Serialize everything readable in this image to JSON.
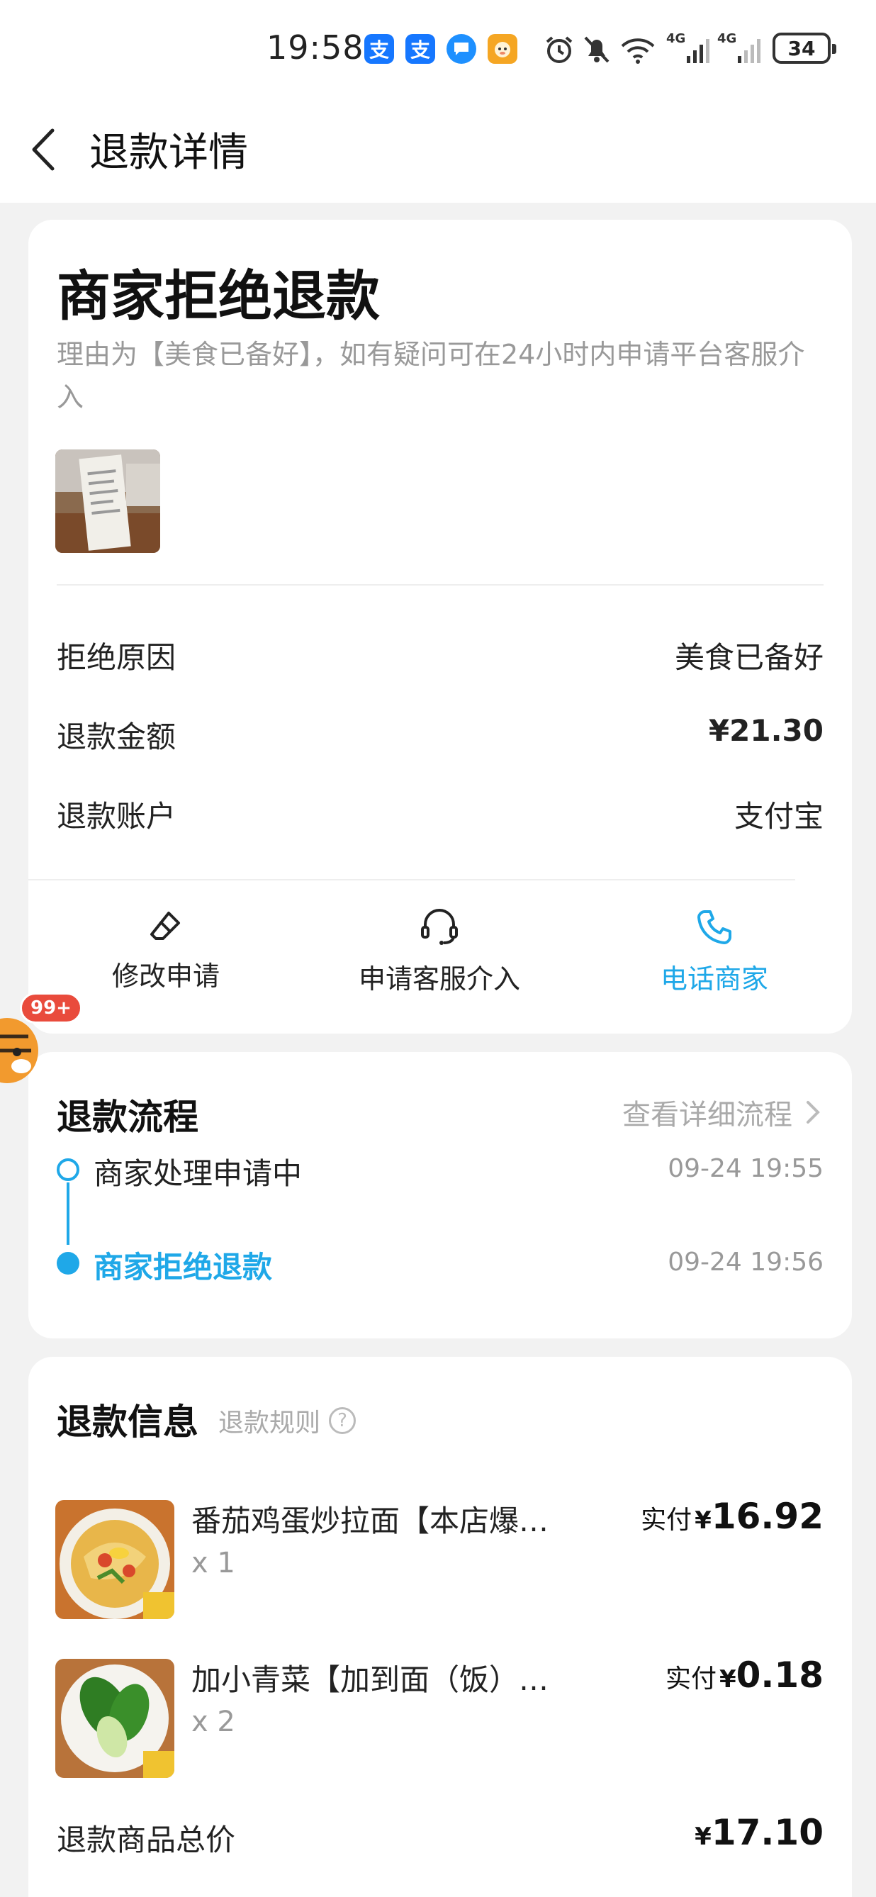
{
  "status_bar": {
    "time": "19:58",
    "battery": "34",
    "network_1": "4G",
    "network_2": "4G"
  },
  "header": {
    "title": "退款详情"
  },
  "refund_status": {
    "title": "商家拒绝退款",
    "description": "理由为【美食已备好】，如有疑问可在24小时内申请平台客服介入"
  },
  "details": [
    {
      "label": "拒绝原因",
      "value": "美食已备好"
    },
    {
      "label": "退款金额",
      "value": "¥21.30"
    },
    {
      "label": "退款账户",
      "value": "支付宝"
    }
  ],
  "actions": [
    {
      "label": "修改申请",
      "icon": "eraser-icon"
    },
    {
      "label": "申请客服介入",
      "icon": "headset-icon"
    },
    {
      "label": "电话商家",
      "icon": "phone-icon"
    }
  ],
  "process": {
    "title": "退款流程",
    "link": "查看详细流程",
    "steps": [
      {
        "text": "商家处理申请中",
        "time": "09-24 19:55"
      },
      {
        "text": "商家拒绝退款",
        "time": "09-24 19:56"
      }
    ]
  },
  "refund_info": {
    "title": "退款信息",
    "rules_link": "退款规则",
    "items": [
      {
        "name": "番茄鸡蛋炒拉面【本店爆…",
        "qty": "x 1",
        "price_prefix": "实付",
        "currency": "¥",
        "price": "16.92"
      },
      {
        "name": "加小青菜【加到面（饭）…",
        "qty": "x 2",
        "price_prefix": "实付",
        "currency": "¥",
        "price": "0.18"
      }
    ],
    "total_label": "退款商品总价",
    "total_currency": "¥",
    "total_value": "17.10"
  },
  "floating": {
    "badge": "99+"
  },
  "colors": {
    "accent": "#1fa8e8",
    "background": "#f2f2f2",
    "muted": "#999999"
  }
}
